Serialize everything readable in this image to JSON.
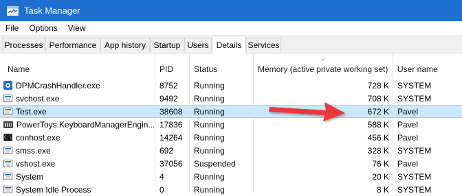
{
  "window": {
    "title": "Task Manager"
  },
  "menu": [
    "File",
    "Options",
    "View"
  ],
  "tabs": [
    "Processes",
    "Performance",
    "App history",
    "Startup",
    "Users",
    "Details",
    "Services"
  ],
  "active_tab": "Details",
  "columns": {
    "name": "Name",
    "pid": "PID",
    "status": "Status",
    "memory": "Memory (active private working set)",
    "user": "User name",
    "sort_indicator": "˅"
  },
  "rows": [
    {
      "name": "DPMCrashHandler.exe",
      "pid": "8752",
      "status": "Running",
      "memory": "728 K",
      "user": "SYSTEM",
      "icon": "blue-circle-icon"
    },
    {
      "name": "svchost.exe",
      "pid": "9492",
      "status": "Running",
      "memory": "708 K",
      "user": "SYSTEM",
      "icon": "app-window-icon"
    },
    {
      "name": "Test.exe",
      "pid": "38608",
      "status": "Running",
      "memory": "672 K",
      "user": "Pavel",
      "icon": "app-window-icon",
      "selected": true
    },
    {
      "name": "PowerToys.KeyboardManagerEngin...",
      "pid": "17836",
      "status": "Running",
      "memory": "588 K",
      "user": "Pavel",
      "icon": "keyboard-icon"
    },
    {
      "name": "conhost.exe",
      "pid": "14264",
      "status": "Running",
      "memory": "456 K",
      "user": "Pavel",
      "icon": "console-icon"
    },
    {
      "name": "smss.exe",
      "pid": "692",
      "status": "Running",
      "memory": "328 K",
      "user": "SYSTEM",
      "icon": "app-window-icon"
    },
    {
      "name": "vshost.exe",
      "pid": "37056",
      "status": "Suspended",
      "memory": "76 K",
      "user": "Pavel",
      "icon": "app-window-icon"
    },
    {
      "name": "System",
      "pid": "4",
      "status": "Running",
      "memory": "20 K",
      "user": "SYSTEM",
      "icon": "app-window-icon"
    },
    {
      "name": "System Idle Process",
      "pid": "0",
      "status": "Running",
      "memory": "8 K",
      "user": "SYSTEM",
      "icon": "app-window-icon"
    }
  ],
  "colors": {
    "titlebar": "#1f6fd0",
    "selection": "#cce8ff",
    "annotation_arrow": "#e8393b"
  }
}
